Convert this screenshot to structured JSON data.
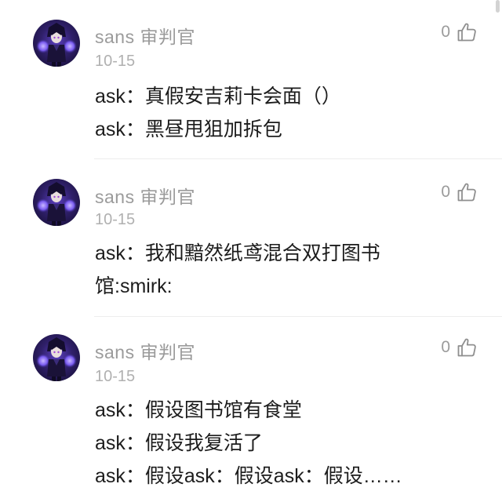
{
  "comments": [
    {
      "username": "sans 审判官",
      "date": "10-15",
      "likes": "0",
      "avatar_icon": "dark-character-avatar",
      "lines": [
        "ask：真假安吉莉卡会面（）",
        "ask：黑昼甩狙加拆包"
      ]
    },
    {
      "username": "sans 审判官",
      "date": "10-15",
      "likes": "0",
      "avatar_icon": "dark-character-avatar",
      "lines": [
        "ask：我和黯然纸鸢混合双打图书",
        "馆:smirk:"
      ]
    },
    {
      "username": "sans 审判官",
      "date": "10-15",
      "likes": "0",
      "avatar_icon": "dark-character-avatar",
      "lines": [
        "ask：假设图书馆有食堂",
        "ask：假设我复活了",
        "ask：假设ask：假设ask：假设……"
      ]
    }
  ],
  "icons": {
    "like": "thumbs-up-icon"
  },
  "colors": {
    "meta_text": "#9b9b9b",
    "body_text": "#1c1c1c",
    "avatar_bg": "#2a1d5c",
    "avatar_glow": "#6d4fd8"
  }
}
